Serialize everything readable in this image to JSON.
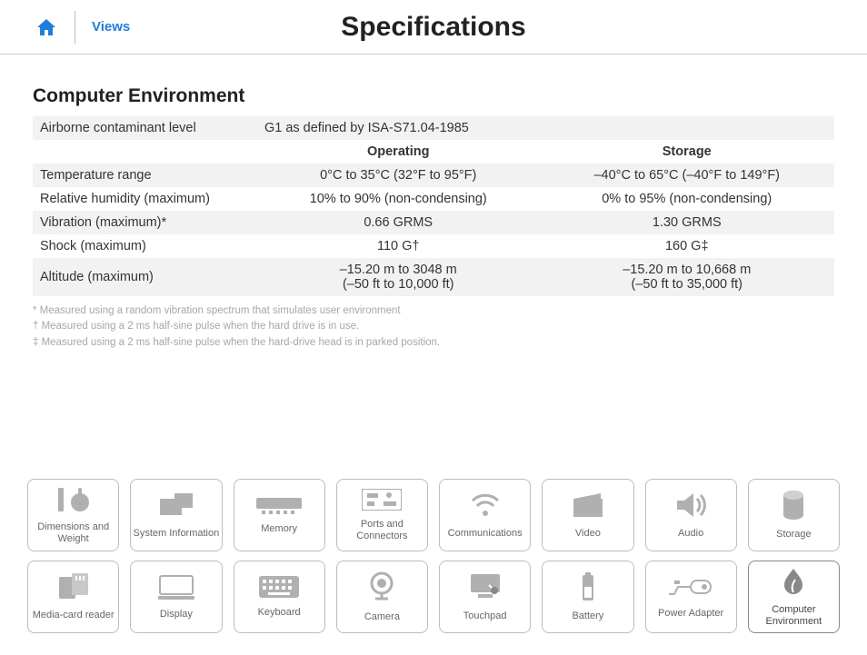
{
  "header": {
    "views_label": "Views",
    "page_title": "Specifications"
  },
  "section": {
    "title": "Computer Environment",
    "airborne_label": "Airborne contaminant level",
    "airborne_value": "G1 as defined by ISA-S71.04-1985",
    "col_operating": "Operating",
    "col_storage": "Storage",
    "rows": [
      {
        "label": "Temperature range",
        "op": "0°C to 35°C (32°F to 95°F)",
        "st": "–40°C to 65°C (–40°F to 149°F)"
      },
      {
        "label": "Relative humidity (maximum)",
        "op": "10% to 90% (non-condensing)",
        "st": "0% to 95% (non-condensing)"
      },
      {
        "label": "Vibration (maximum)*",
        "op": "0.66 GRMS",
        "st": "1.30 GRMS"
      },
      {
        "label": "Shock (maximum)",
        "op": "110 G†",
        "st": "160 G‡"
      },
      {
        "label": "Altitude (maximum)",
        "op": "–15.20 m to 3048 m\n(–50 ft to 10,000 ft)",
        "st": "–15.20 m to 10,668 m\n(–50 ft to 35,000 ft)"
      }
    ]
  },
  "footnotes": [
    "* Measured using a random vibration spectrum that simulates user environment",
    "† Measured using a 2 ms half-sine pulse when the hard drive is in use.",
    "‡ Measured using a 2 ms half-sine pulse when the hard-drive head is in parked position."
  ],
  "nav": {
    "row1": [
      {
        "id": "dimensions",
        "label": "Dimensions and Weight"
      },
      {
        "id": "sysinfo",
        "label": "System Information"
      },
      {
        "id": "memory",
        "label": "Memory"
      },
      {
        "id": "ports",
        "label": "Ports and Connectors"
      },
      {
        "id": "comm",
        "label": "Communications"
      },
      {
        "id": "video",
        "label": "Video"
      },
      {
        "id": "audio",
        "label": "Audio"
      },
      {
        "id": "storage",
        "label": "Storage"
      }
    ],
    "row2": [
      {
        "id": "mediacard",
        "label": "Media-card reader"
      },
      {
        "id": "display",
        "label": "Display"
      },
      {
        "id": "keyboard",
        "label": "Keyboard"
      },
      {
        "id": "camera",
        "label": "Camera"
      },
      {
        "id": "touchpad",
        "label": "Touchpad"
      },
      {
        "id": "battery",
        "label": "Battery"
      },
      {
        "id": "power",
        "label": "Power Adapter"
      },
      {
        "id": "env",
        "label": "Computer Environment",
        "active": true
      }
    ]
  }
}
